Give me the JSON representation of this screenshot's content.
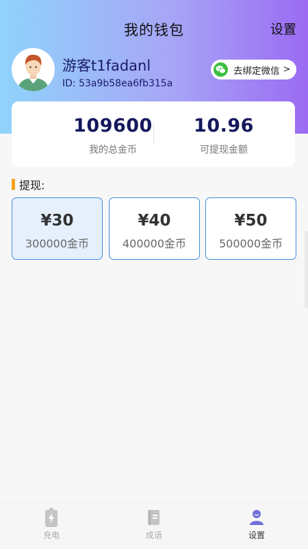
{
  "header": {
    "title": "我的钱包",
    "settings_label": "设置"
  },
  "user": {
    "name": "游客t1fadanl",
    "id": "ID: 53a9b58ea6fb315a",
    "bind_wechat_label": "去绑定微信",
    "bind_chevron": ">"
  },
  "stats": {
    "total_coins_value": "109600",
    "total_coins_label": "我的总金币",
    "withdrawable_value": "10.96",
    "withdrawable_label": "可提现金额"
  },
  "withdraw": {
    "section_title": "提现:",
    "options": [
      {
        "price": "¥30",
        "coins": "300000金币",
        "selected": true
      },
      {
        "price": "¥40",
        "coins": "400000金币",
        "selected": false
      },
      {
        "price": "¥50",
        "coins": "500000金币",
        "selected": false
      }
    ]
  },
  "tabbar": {
    "items": [
      {
        "label": "充电",
        "icon": "battery-icon",
        "active": false
      },
      {
        "label": "成语",
        "icon": "book-icon",
        "active": false
      },
      {
        "label": "设置",
        "icon": "person-icon",
        "active": true
      }
    ]
  },
  "colors": {
    "header_gradient_start": "#8fd3fb",
    "header_gradient_end": "#9b6bf3",
    "accent_blue": "#3d8be0",
    "section_bar": "#f7a11b",
    "wechat_green": "#3bbf41",
    "stat_value": "#14185c"
  }
}
